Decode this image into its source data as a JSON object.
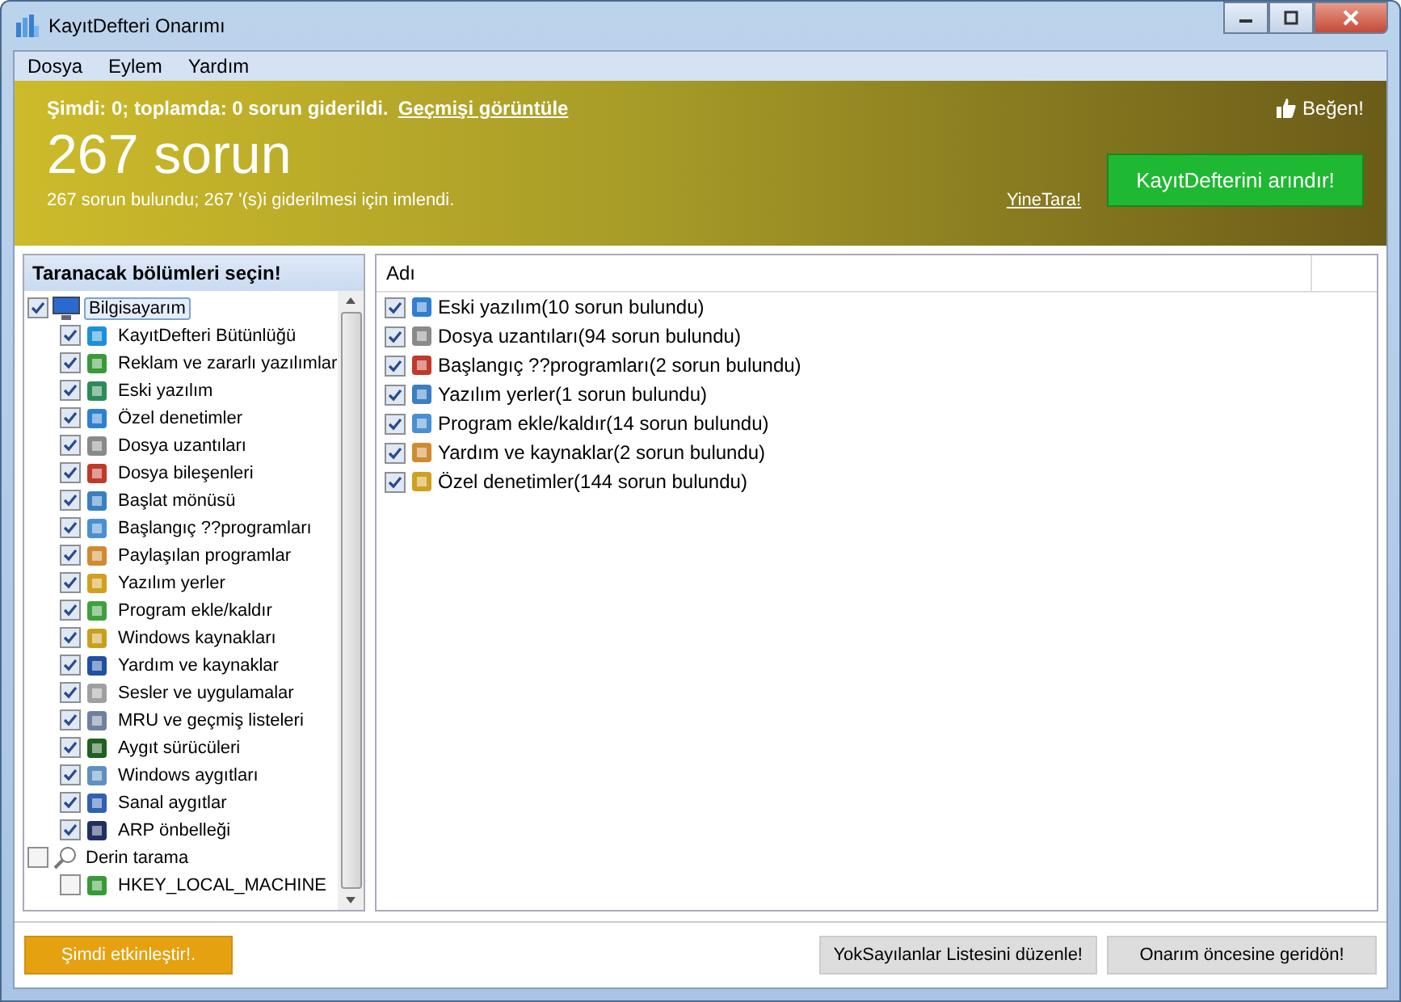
{
  "window": {
    "title": "KayıtDefteri Onarımı"
  },
  "menu": [
    "Dosya",
    "Eylem",
    "Yardım"
  ],
  "banner": {
    "status": "Şimdi: 0; toplamda: 0 sorun giderildi.",
    "history_link": "Geçmişi görüntüle",
    "like": "Beğen!",
    "headline": "267 sorun",
    "summary": "267 sorun bulundu; 267 '(s)i giderilmesi için imlendi.",
    "rescan_link": "YineTara!",
    "clean_button": "KayıtDefterini arındır!"
  },
  "sections": {
    "title": "Taranacak bölümleri seçin!",
    "tree": [
      {
        "label": "Bilgisayarım",
        "checked": true,
        "selected": true,
        "children": [
          {
            "label": "KayıtDefteri Bütünlüğü",
            "checked": true,
            "selected": false
          },
          {
            "label": "Reklam ve zararlı yazılımlar",
            "checked": true,
            "selected": false
          },
          {
            "label": "Eski yazılım",
            "checked": true,
            "selected": false
          },
          {
            "label": "Özel denetimler",
            "checked": true,
            "selected": false
          },
          {
            "label": "Dosya uzantıları",
            "checked": true,
            "selected": false
          },
          {
            "label": "Dosya bileşenleri",
            "checked": true,
            "selected": false
          },
          {
            "label": "Başlat mönüsü",
            "checked": true,
            "selected": false
          },
          {
            "label": "Başlangıç ??programları",
            "checked": true,
            "selected": false
          },
          {
            "label": "Paylaşılan programlar",
            "checked": true,
            "selected": false
          },
          {
            "label": "Yazılım yerler",
            "checked": true,
            "selected": false
          },
          {
            "label": "Program ekle/kaldır",
            "checked": true,
            "selected": false
          },
          {
            "label": "Windows kaynakları",
            "checked": true,
            "selected": false
          },
          {
            "label": "Yardım ve kaynaklar",
            "checked": true,
            "selected": false
          },
          {
            "label": "Sesler ve uygulamalar",
            "checked": true,
            "selected": false
          },
          {
            "label": "MRU ve geçmiş listeleri",
            "checked": true,
            "selected": false
          },
          {
            "label": "Aygıt sürücüleri",
            "checked": true,
            "selected": false
          },
          {
            "label": "Windows aygıtları",
            "checked": true,
            "selected": false
          },
          {
            "label": "Sanal aygıtlar",
            "checked": true,
            "selected": false
          },
          {
            "label": "ARP önbelleği",
            "checked": true,
            "selected": false
          }
        ]
      },
      {
        "label": "Derin tarama",
        "checked": false,
        "selected": false,
        "children": [
          {
            "label": "HKEY_LOCAL_MACHINE",
            "checked": false,
            "selected": false
          }
        ]
      }
    ]
  },
  "results": {
    "column": "Adı",
    "rows": [
      {
        "label": "Eski yazılım(10 sorun bulundu)",
        "checked": true
      },
      {
        "label": "Dosya uzantıları(94 sorun bulundu)",
        "checked": true
      },
      {
        "label": "Başlangıç ??programları(2 sorun bulundu)",
        "checked": true
      },
      {
        "label": "Yazılım yerler(1 sorun bulundu)",
        "checked": true
      },
      {
        "label": "Program ekle/kaldır(14 sorun bulundu)",
        "checked": true
      },
      {
        "label": "Yardım ve kaynaklar(2 sorun bulundu)",
        "checked": true
      },
      {
        "label": "Özel denetimler(144 sorun bulundu)",
        "checked": true
      }
    ]
  },
  "footer": {
    "activate_button": "Şimdi etkinleştir!.",
    "ignore_button": "YokSayılanlar Listesini düzenle!",
    "restore_button": "Onarım öncesine geridön!"
  }
}
